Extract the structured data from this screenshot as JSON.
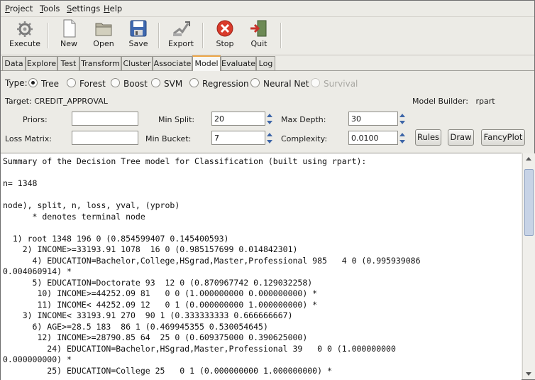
{
  "menu": [
    "Project",
    "Tools",
    "Settings",
    "Help"
  ],
  "toolbar": {
    "execute": "Execute",
    "new": "New",
    "open": "Open",
    "save": "Save",
    "export": "Export",
    "stop": "Stop",
    "quit": "Quit"
  },
  "tabs": [
    "Data",
    "Explore",
    "Test",
    "Transform",
    "Cluster",
    "Associate",
    "Model",
    "Evaluate",
    "Log"
  ],
  "active_tab": "Model",
  "model": {
    "type_label": "Type:",
    "types": [
      "Tree",
      "Forest",
      "Boost",
      "SVM",
      "Regression",
      "Neural Net",
      "Survival"
    ],
    "selected_type": "Tree",
    "target_label": "Target:",
    "target_value": "CREDIT_APPROVAL",
    "builder_label": "Model Builder:",
    "builder_value": "rpart",
    "priors_label": "Priors:",
    "priors_value": "",
    "loss_label": "Loss Matrix:",
    "loss_value": "",
    "min_split_label": "Min Split:",
    "min_split_value": "20",
    "min_bucket_label": "Min Bucket:",
    "min_bucket_value": "7",
    "max_depth_label": "Max Depth:",
    "max_depth_value": "30",
    "complexity_label": "Complexity:",
    "complexity_value": "0.0100",
    "rules_button": "Rules",
    "draw_button": "Draw",
    "fancyplot_button": "FancyPlot"
  },
  "output_lines": [
    "Summary of the Decision Tree model for Classification (built using rpart):",
    "",
    "n= 1348",
    "",
    "node), split, n, loss, yval, (yprob)",
    "      * denotes terminal node",
    "",
    "  1) root 1348 196 0 (0.854599407 0.145400593)",
    "    2) INCOME>=33193.91 1078  16 0 (0.985157699 0.014842301)",
    "      4) EDUCATION=Bachelor,College,HSgrad,Master,Professional 985   4 0 (0.995939086",
    "0.004060914) *",
    "      5) EDUCATION=Doctorate 93  12 0 (0.870967742 0.129032258)",
    "       10) INCOME>=44252.09 81   0 0 (1.000000000 0.000000000) *",
    "       11) INCOME< 44252.09 12   0 1 (0.000000000 1.000000000) *",
    "    3) INCOME< 33193.91 270  90 1 (0.333333333 0.666666667)",
    "      6) AGE>=28.5 183  86 1 (0.469945355 0.530054645)",
    "       12) INCOME>=28790.85 64  25 0 (0.609375000 0.390625000)",
    "         24) EDUCATION=Bachelor,HSgrad,Master,Professional 39   0 0 (1.000000000",
    "0.000000000) *",
    "         25) EDUCATION=College 25   0 1 (0.000000000 1.000000000) *"
  ]
}
